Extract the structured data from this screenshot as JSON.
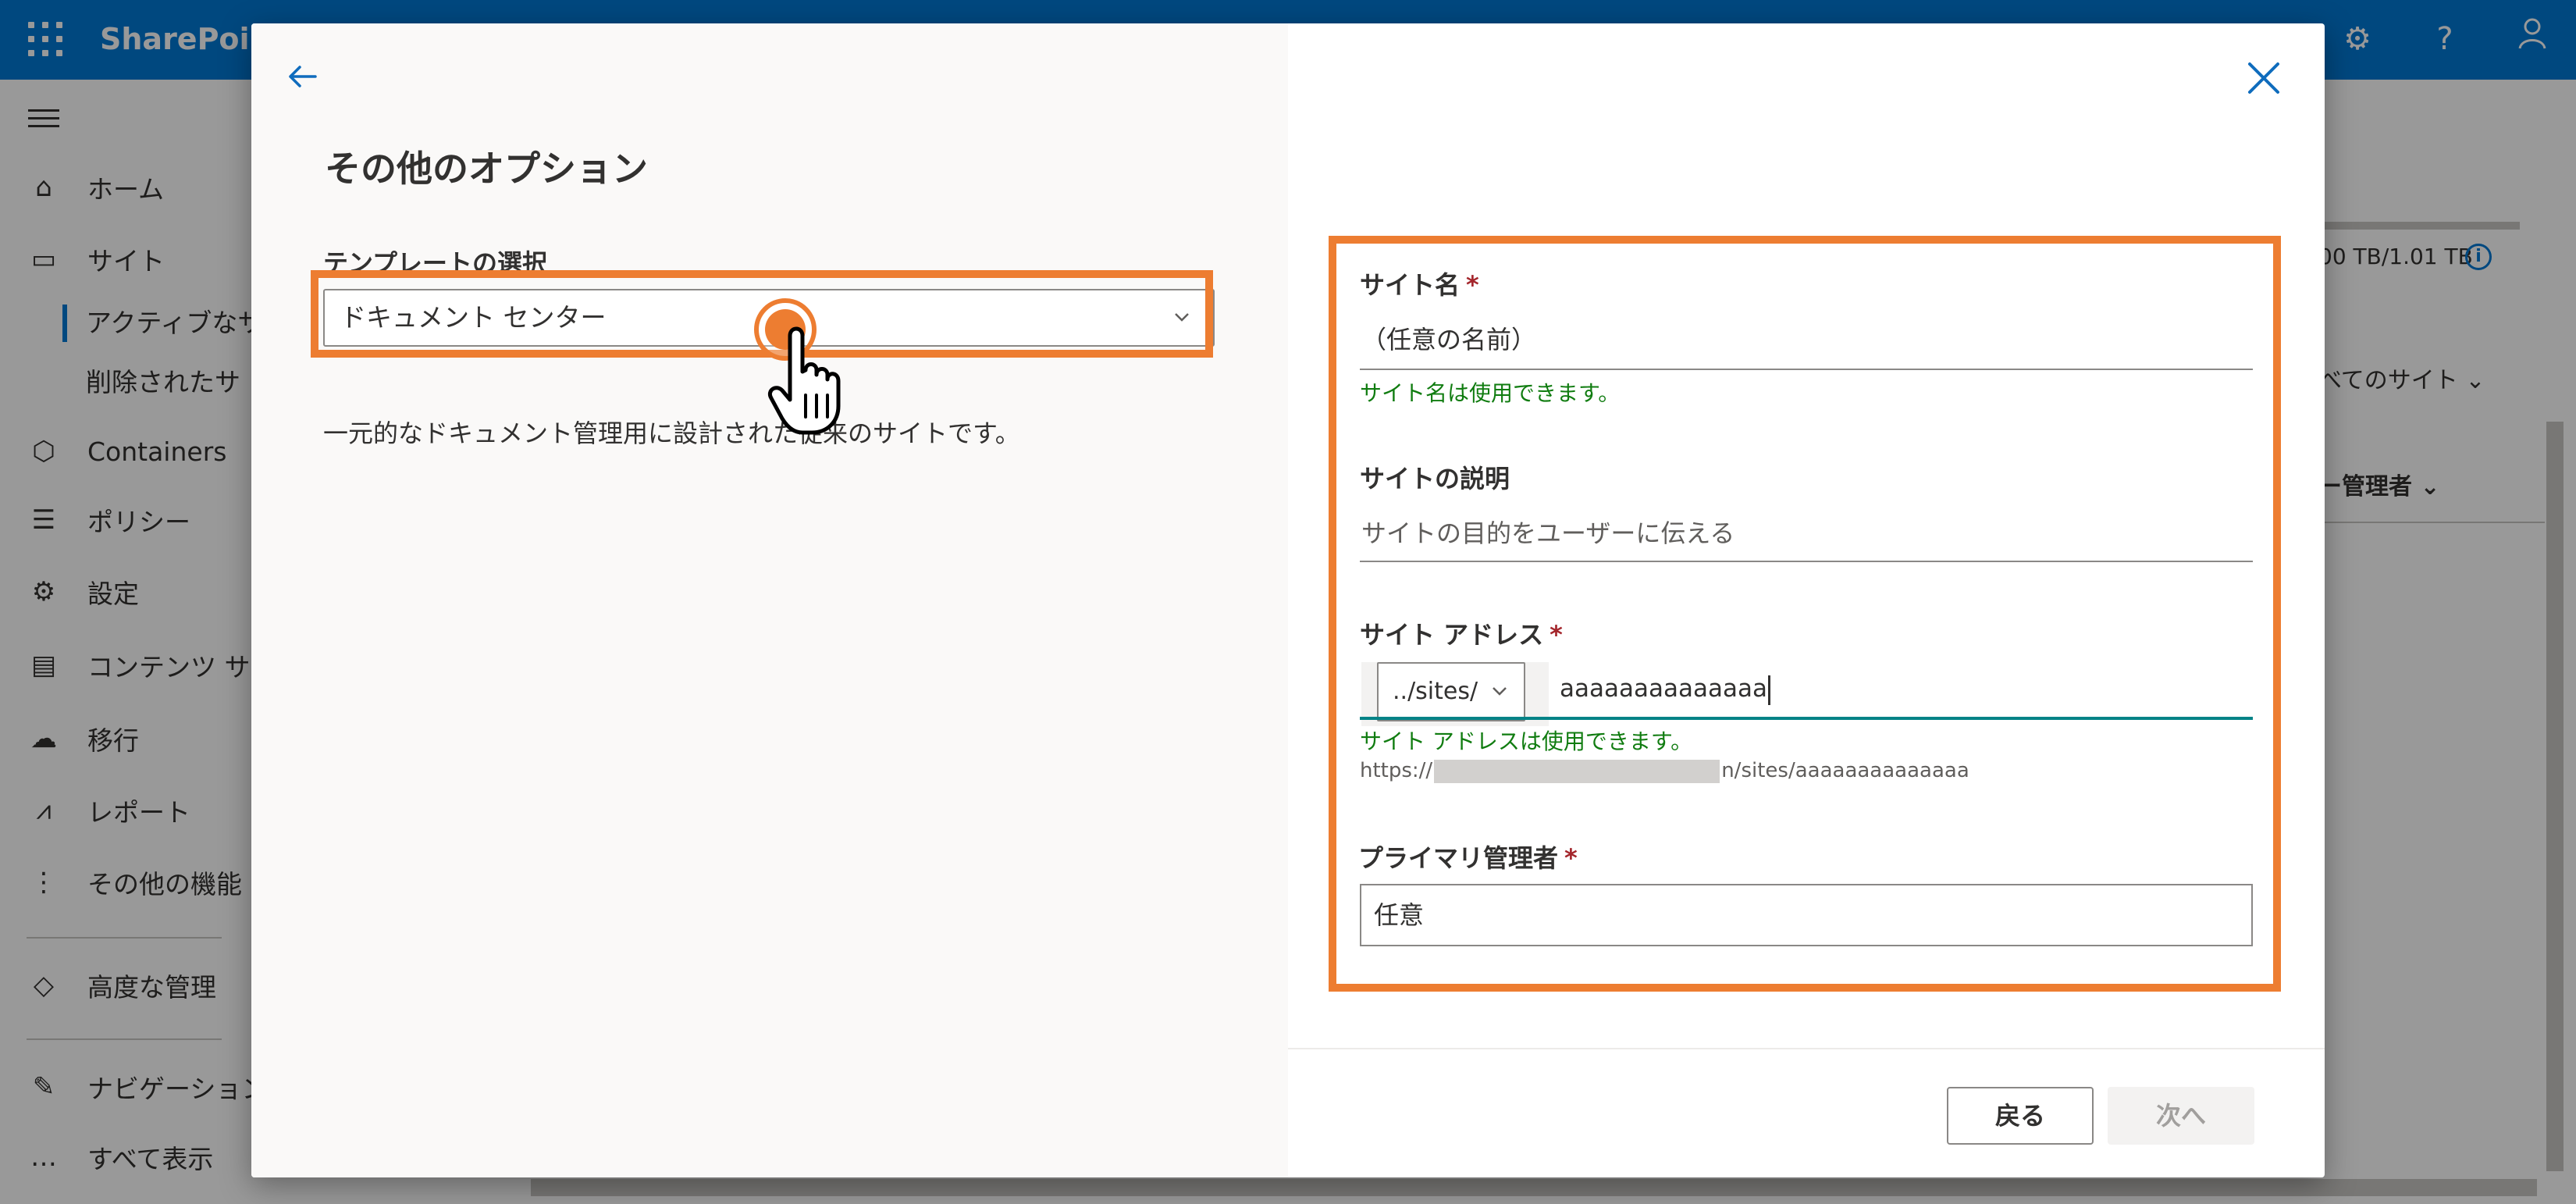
{
  "app": {
    "brand": "SharePoint",
    "header_icons": [
      "gear-icon",
      "help-icon",
      "person-icon"
    ]
  },
  "nav": {
    "items": [
      {
        "label": "ホーム",
        "icon": "home-icon"
      },
      {
        "label": "サイト",
        "icon": "sites-icon"
      },
      {
        "label": "Containers",
        "icon": "containers-icon"
      },
      {
        "label": "ポリシー",
        "icon": "policy-icon"
      },
      {
        "label": "設定",
        "icon": "settings-icon"
      },
      {
        "label": "コンテンツ サ",
        "icon": "content-icon"
      },
      {
        "label": "移行",
        "icon": "migration-icon"
      },
      {
        "label": "レポート",
        "icon": "reports-icon"
      },
      {
        "label": "その他の機能",
        "icon": "more-icon"
      },
      {
        "label": "高度な管理",
        "icon": "advanced-icon"
      },
      {
        "label": "ナビゲーション",
        "icon": "edit-icon"
      },
      {
        "label": "すべて表示",
        "icon": "ellipsis-icon"
      }
    ],
    "subitems": [
      "アクティブなサ",
      "削除されたサ"
    ]
  },
  "background": {
    "storage": "00 TB/1.01 TB",
    "all_sites": "べてのサイト",
    "admin_col": "ー管理者"
  },
  "dialog": {
    "title": "その他のオプション",
    "template": {
      "label": "テンプレートの選択",
      "value": "ドキュメント センター",
      "description": "一元的なドキュメント管理用に設計された従来のサイトです。"
    },
    "form": {
      "site_name": {
        "label": "サイト名",
        "required": "*",
        "value": "（任意の名前）",
        "status": "サイト名は使用できます。"
      },
      "site_description": {
        "label": "サイトの説明",
        "placeholder": "サイトの目的をユーザーに伝える"
      },
      "site_address": {
        "label": "サイト アドレス",
        "required": "*",
        "prefix": "../sites/",
        "value": "aaaaaaaaaaaaaa",
        "status": "サイト アドレスは使用できます。",
        "url_start": "https://",
        "url_end": "n/sites/aaaaaaaaaaaaaa"
      },
      "primary_admin": {
        "label": "プライマリ管理者",
        "required": "*",
        "value": "任意"
      }
    },
    "buttons": {
      "back": "戻る",
      "next": "次へ"
    }
  },
  "colors": {
    "accent": "#0078d4",
    "highlight": "#ed7d31",
    "success": "#107c10"
  }
}
